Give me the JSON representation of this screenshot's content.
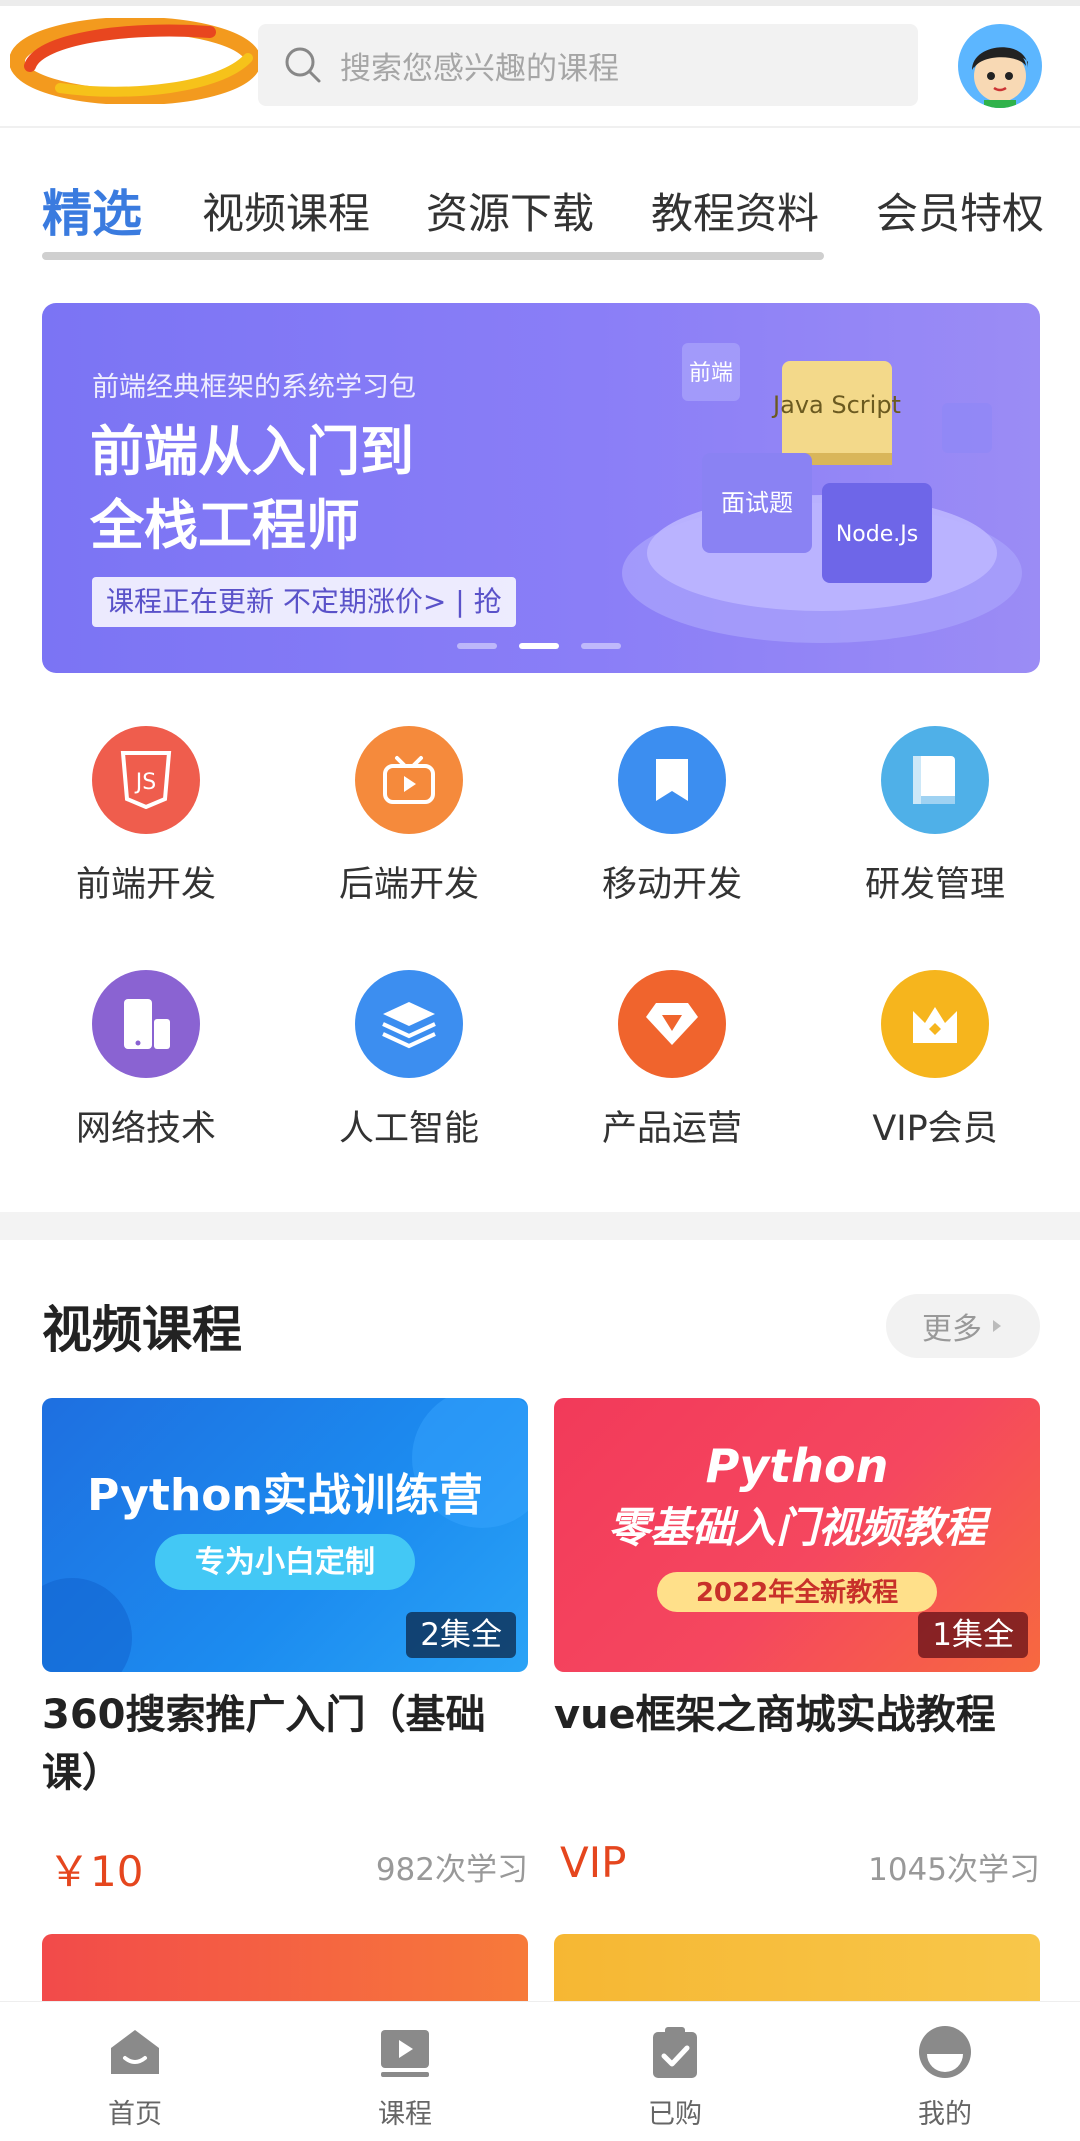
{
  "header": {
    "search_placeholder": "搜索您感兴趣的课程"
  },
  "tabs": [
    {
      "label": "精选",
      "active": true
    },
    {
      "label": "视频课程"
    },
    {
      "label": "资源下载"
    },
    {
      "label": "教程资料"
    },
    {
      "label": "会员特权"
    }
  ],
  "banner": {
    "subtitle": "前端经典框架的系统学习包",
    "title_line1": "前端从入门到",
    "title_line2": "全栈工程师",
    "pill": "课程正在更新 不定期涨价> | 抢",
    "cube_labels": [
      "Java Script",
      "前端",
      "面试题",
      "Node.Js"
    ],
    "active_dot": 2,
    "dot_count": 3
  },
  "categories": [
    {
      "label": "前端开发",
      "icon": "js-icon",
      "color": "#ef5d4d"
    },
    {
      "label": "后端开发",
      "icon": "play-tv-icon",
      "color": "#f58a3c"
    },
    {
      "label": "移动开发",
      "icon": "bookmark-icon",
      "color": "#3c8ef0"
    },
    {
      "label": "研发管理",
      "icon": "book-icon",
      "color": "#4fb0e8"
    },
    {
      "label": "网络技术",
      "icon": "devices-icon",
      "color": "#8a63d2"
    },
    {
      "label": "人工智能",
      "icon": "layers-icon",
      "color": "#3c8ef0"
    },
    {
      "label": "产品运营",
      "icon": "diamond-icon",
      "color": "#f0642d"
    },
    {
      "label": "VIP会员",
      "icon": "crown-icon",
      "color": "#f6b51d"
    }
  ],
  "section": {
    "title": "视频课程",
    "more_label": "更多"
  },
  "courses": [
    {
      "thumb_title": "Python实战训练营",
      "thumb_sub": "专为小白定制",
      "episodes": "2集全",
      "title": "360搜索推广入门（基础课）",
      "price": "￥10",
      "learned": "982次学习"
    },
    {
      "thumb_title": "Python",
      "thumb_title2": "零基础入门视频教程",
      "thumb_sub": "2022年全新教程",
      "episodes": "1集全",
      "title": "vue框架之商城实战教程",
      "price": "VIP",
      "learned": "1045次学习"
    }
  ],
  "bottom_nav": [
    {
      "label": "首页",
      "icon": "home-icon"
    },
    {
      "label": "课程",
      "icon": "video-icon"
    },
    {
      "label": "已购",
      "icon": "clipboard-check-icon"
    },
    {
      "label": "我的",
      "icon": "profile-icon"
    }
  ],
  "colors": {
    "accent": "#3a7bdf",
    "price": "#e5461e",
    "banner": "#7b74f4"
  }
}
